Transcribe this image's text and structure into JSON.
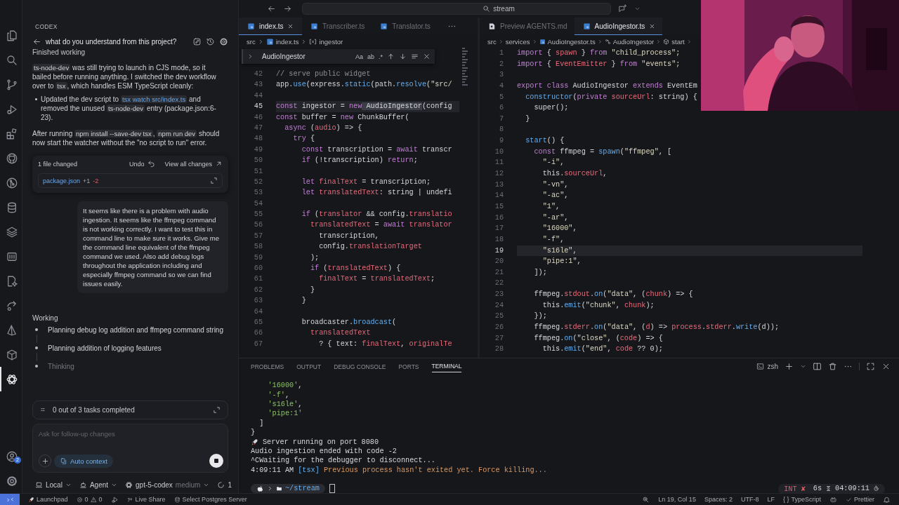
{
  "titlebar": {
    "search": "stream"
  },
  "activity_bar": {
    "items": [
      {
        "selected": false
      },
      {
        "selected": false
      },
      {
        "selected": false
      },
      {
        "selected": false
      },
      {
        "selected": false
      },
      {
        "selected": false
      },
      {
        "selected": false
      },
      {
        "selected": false
      },
      {
        "selected": false
      },
      {
        "selected": false
      },
      {
        "selected": false
      },
      {
        "selected": false
      },
      {
        "selected": false
      },
      {
        "selected": false
      },
      {
        "selected": true
      }
    ],
    "account_badge": "2"
  },
  "codex": {
    "title": "CODEX",
    "thread_title": "what do you understand from this project?",
    "status": "Finished working",
    "blocks": [
      {
        "kind": "para",
        "segs": [
          {
            "text": "ts-node-dev",
            "kind": "code"
          },
          {
            "text": " was still trying to launch in CJS mode, so it bailed before running anything. I switched the dev workflow over to ",
            "kind": "plain"
          },
          {
            "text": "tsx",
            "kind": "code"
          },
          {
            "text": ", which handles ESM TypeScript cleanly:",
            "kind": "plain"
          }
        ]
      },
      {
        "kind": "bullet",
        "segs": [
          {
            "text": "Updated the dev script to ",
            "kind": "plain"
          },
          {
            "text": "tsx watch src/index.ts",
            "kind": "link"
          },
          {
            "text": " and removed the unused ",
            "kind": "plain"
          },
          {
            "text": "ts-node-dev",
            "kind": "code"
          },
          {
            "text": " entry (package.json:6-23).",
            "kind": "plain"
          }
        ]
      },
      {
        "kind": "para",
        "segs": [
          {
            "text": "After running ",
            "kind": "plain"
          },
          {
            "text": "npm install --save-dev tsx",
            "kind": "code"
          },
          {
            "text": ", ",
            "kind": "plain"
          },
          {
            "text": "npm run dev",
            "kind": "code"
          },
          {
            "text": " should now start the watcher without the \"no script to run\" error.",
            "kind": "plain"
          }
        ]
      }
    ],
    "changes": {
      "summary": "1 file changed",
      "undo": "Undo",
      "view_all": "View all changes",
      "file": "package.json",
      "added": "+1",
      "removed": "-2"
    },
    "user_message": "It seems like there is a problem with audio ingestion. It seems like the ffmpeg command is not working correctly. I want to test this in command line to make sure it works. Give me the command line equivalent of the ffmpeg command we used. Also add debug logs throughout the application including and especially ffmpeg command so we can find issues easily.",
    "working": {
      "title": "Working",
      "steps": [
        {
          "text": "Planning debug log addition and ffmpeg command string",
          "current": false
        },
        {
          "text": "Planning addition of logging features",
          "current": false
        },
        {
          "text": "Thinking",
          "current": true
        }
      ]
    },
    "tasks": "0 out of 3 tasks completed",
    "composer": {
      "placeholder": "Ask for follow-up changes",
      "context": "Auto context"
    },
    "footer": {
      "location": "Local",
      "mode": "Agent",
      "model": "gpt-5-codex",
      "effort": "medium",
      "usage": "1"
    }
  },
  "editors": [
    {
      "tabs": [
        {
          "label": "index.ts",
          "kind": "ts",
          "selected": true
        },
        {
          "label": "Transcriber.ts",
          "kind": "ts",
          "selected": false
        },
        {
          "label": "Translator.ts",
          "kind": "ts",
          "selected": false
        }
      ],
      "breadcrumbs": [
        {
          "label": "src",
          "kind": "folder"
        },
        {
          "label": "index.ts",
          "kind": "file"
        },
        {
          "label": "ingestor",
          "kind": "variable"
        }
      ],
      "find": {
        "query": "AudioIngestor",
        "options": [
          "Aa",
          "ab",
          ".*"
        ]
      },
      "lines": [
        {
          "n": "42",
          "current": false,
          "segs": [
            {
              "text": "// serve public widget",
              "kind": "c"
            }
          ]
        },
        {
          "n": "43",
          "current": false,
          "segs": [
            {
              "text": "app.",
              "kind": "p"
            },
            {
              "text": "use",
              "kind": "f"
            },
            {
              "text": "(express.",
              "kind": "p"
            },
            {
              "text": "static",
              "kind": "f"
            },
            {
              "text": "(path.",
              "kind": "p"
            },
            {
              "text": "resolve",
              "kind": "f"
            },
            {
              "text": "(\"src/",
              "kind": "s"
            }
          ]
        },
        {
          "n": "44",
          "current": false
        },
        {
          "n": "45",
          "current": true,
          "segs": [
            {
              "text": "const",
              "kind": "k"
            },
            {
              "text": " ingestor = ",
              "kind": "p"
            },
            {
              "text": "new",
              "kind": "k"
            },
            {
              "text": " AudioIngestor",
              "kind": "m"
            },
            {
              "text": "(config",
              "kind": "p"
            }
          ]
        },
        {
          "n": "46",
          "current": false,
          "segs": [
            {
              "text": "const",
              "kind": "k"
            },
            {
              "text": " buffer = ",
              "kind": "p"
            },
            {
              "text": "new",
              "kind": "k"
            },
            {
              "text": " ChunkBuffer(",
              "kind": "p"
            }
          ]
        },
        {
          "n": "47",
          "current": false,
          "segs": [
            {
              "text": "  async",
              "kind": "k"
            },
            {
              "text": " (",
              "kind": "p"
            },
            {
              "text": "audio",
              "kind": "v"
            },
            {
              "text": ") => {",
              "kind": "p"
            }
          ]
        },
        {
          "n": "48",
          "current": false,
          "segs": [
            {
              "text": "    try",
              "kind": "k"
            },
            {
              "text": " {",
              "kind": "p"
            }
          ]
        },
        {
          "n": "49",
          "current": false,
          "segs": [
            {
              "text": "      const",
              "kind": "k"
            },
            {
              "text": " transcription = ",
              "kind": "p"
            },
            {
              "text": "await",
              "kind": "k"
            },
            {
              "text": " transcr",
              "kind": "p"
            }
          ]
        },
        {
          "n": "50",
          "current": false,
          "segs": [
            {
              "text": "      if",
              "kind": "k"
            },
            {
              "text": " (!transcription) ",
              "kind": "p"
            },
            {
              "text": "return",
              "kind": "k"
            },
            {
              "text": ";",
              "kind": "p"
            }
          ]
        },
        {
          "n": "51",
          "current": false
        },
        {
          "n": "52",
          "current": false,
          "segs": [
            {
              "text": "      let",
              "kind": "k"
            },
            {
              "text": " finalText",
              "kind": "v"
            },
            {
              "text": " = transcription;",
              "kind": "p"
            }
          ]
        },
        {
          "n": "53",
          "current": false,
          "segs": [
            {
              "text": "      let",
              "kind": "k"
            },
            {
              "text": " translatedText",
              "kind": "v"
            },
            {
              "text": ": string | undefi",
              "kind": "p"
            }
          ]
        },
        {
          "n": "54",
          "current": false
        },
        {
          "n": "55",
          "current": false,
          "segs": [
            {
              "text": "      if",
              "kind": "k"
            },
            {
              "text": " (",
              "kind": "p"
            },
            {
              "text": "translator",
              "kind": "v"
            },
            {
              "text": " && config.",
              "kind": "p"
            },
            {
              "text": "translatio",
              "kind": "v"
            }
          ]
        },
        {
          "n": "56",
          "current": false,
          "segs": [
            {
              "text": "        translatedText",
              "kind": "v"
            },
            {
              "text": " = ",
              "kind": "p"
            },
            {
              "text": "await",
              "kind": "k"
            },
            {
              "text": " translator",
              "kind": "v"
            }
          ]
        },
        {
          "n": "57",
          "current": false,
          "segs": [
            {
              "text": "          transcription,",
              "kind": "p"
            }
          ]
        },
        {
          "n": "58",
          "current": false,
          "segs": [
            {
              "text": "          config.",
              "kind": "p"
            },
            {
              "text": "translationTarget",
              "kind": "v"
            }
          ]
        },
        {
          "n": "59",
          "current": false,
          "segs": [
            {
              "text": "        );",
              "kind": "p"
            }
          ]
        },
        {
          "n": "60",
          "current": false,
          "segs": [
            {
              "text": "        if",
              "kind": "k"
            },
            {
              "text": " (",
              "kind": "p"
            },
            {
              "text": "translatedText",
              "kind": "v"
            },
            {
              "text": ") {",
              "kind": "p"
            }
          ]
        },
        {
          "n": "61",
          "current": false,
          "segs": [
            {
              "text": "          finalText",
              "kind": "v"
            },
            {
              "text": " = ",
              "kind": "p"
            },
            {
              "text": "translatedText",
              "kind": "v"
            },
            {
              "text": ";",
              "kind": "p"
            }
          ]
        },
        {
          "n": "62",
          "current": false,
          "segs": [
            {
              "text": "        }",
              "kind": "p"
            }
          ]
        },
        {
          "n": "63",
          "current": false,
          "segs": [
            {
              "text": "      }",
              "kind": "p"
            }
          ]
        },
        {
          "n": "64",
          "current": false
        },
        {
          "n": "65",
          "current": false,
          "segs": [
            {
              "text": "      broadcaster.",
              "kind": "p"
            },
            {
              "text": "broadcast",
              "kind": "f"
            },
            {
              "text": "(",
              "kind": "p"
            }
          ]
        },
        {
          "n": "66",
          "current": false,
          "segs": [
            {
              "text": "        translatedText",
              "kind": "v"
            }
          ]
        },
        {
          "n": "67",
          "current": false,
          "segs": [
            {
              "text": "          ? { text: ",
              "kind": "p"
            },
            {
              "text": "finalText",
              "kind": "v"
            },
            {
              "text": ", ",
              "kind": "p"
            },
            {
              "text": "originalTe",
              "kind": "v"
            }
          ]
        }
      ]
    },
    {
      "tabs": [
        {
          "label": "Preview AGENTS.md",
          "kind": "preview",
          "selected": false
        },
        {
          "label": "AudioIngestor.ts",
          "kind": "ts",
          "selected": true
        }
      ],
      "breadcrumbs": [
        {
          "label": "src",
          "kind": "folder"
        },
        {
          "label": "services",
          "kind": "folder"
        },
        {
          "label": "AudioIngestor.ts",
          "kind": "file"
        },
        {
          "label": "AudioIngestor",
          "kind": "class"
        },
        {
          "label": "start",
          "kind": "method"
        }
      ],
      "breadcrumb_more": true,
      "lines": [
        {
          "n": "1",
          "current": false,
          "segs": [
            {
              "text": "import",
              "kind": "k"
            },
            {
              "text": " { ",
              "kind": "p"
            },
            {
              "text": "spawn",
              "kind": "v"
            },
            {
              "text": " } ",
              "kind": "p"
            },
            {
              "text": "from",
              "kind": "k"
            },
            {
              "text": " \"child_process\";",
              "kind": "s"
            }
          ]
        },
        {
          "n": "2",
          "current": false,
          "segs": [
            {
              "text": "import",
              "kind": "k"
            },
            {
              "text": " { ",
              "kind": "p"
            },
            {
              "text": "EventEmitter",
              "kind": "v"
            },
            {
              "text": " } ",
              "kind": "p"
            },
            {
              "text": "from",
              "kind": "k"
            },
            {
              "text": " \"events\";",
              "kind": "s"
            }
          ]
        },
        {
          "n": "3",
          "current": false
        },
        {
          "n": "4",
          "current": false,
          "segs": [
            {
              "text": "export class",
              "kind": "k"
            },
            {
              "text": " AudioIngestor ",
              "kind": "p"
            },
            {
              "text": "extends",
              "kind": "k"
            },
            {
              "text": " EventEm",
              "kind": "p"
            }
          ]
        },
        {
          "n": "5",
          "current": false,
          "segs": [
            {
              "text": "  constructor",
              "kind": "f"
            },
            {
              "text": "(",
              "kind": "p"
            },
            {
              "text": "private",
              "kind": "k"
            },
            {
              "text": " sourceUrl",
              "kind": "v"
            },
            {
              "text": ": string) {",
              "kind": "p"
            }
          ]
        },
        {
          "n": "6",
          "current": false,
          "segs": [
            {
              "text": "    super();",
              "kind": "p"
            }
          ]
        },
        {
          "n": "7",
          "current": false,
          "segs": [
            {
              "text": "  }",
              "kind": "p"
            }
          ]
        },
        {
          "n": "8",
          "current": false
        },
        {
          "n": "9",
          "current": false,
          "segs": [
            {
              "text": "  start",
              "kind": "f"
            },
            {
              "text": "() {",
              "kind": "p"
            }
          ]
        },
        {
          "n": "10",
          "current": false,
          "segs": [
            {
              "text": "    const",
              "kind": "k"
            },
            {
              "text": " ffmpeg = ",
              "kind": "p"
            },
            {
              "text": "spawn",
              "kind": "f"
            },
            {
              "text": "(",
              "kind": "p"
            },
            {
              "text": "\"ffmpeg\"",
              "kind": "s"
            },
            {
              "text": ", [",
              "kind": "p"
            }
          ]
        },
        {
          "n": "11",
          "current": false,
          "segs": [
            {
              "text": "      \"-i\"",
              "kind": "s"
            },
            {
              "text": ",",
              "kind": "p"
            }
          ]
        },
        {
          "n": "12",
          "current": false,
          "segs": [
            {
              "text": "      this.",
              "kind": "p"
            },
            {
              "text": "sourceUrl",
              "kind": "v"
            },
            {
              "text": ",",
              "kind": "p"
            }
          ]
        },
        {
          "n": "13",
          "current": false,
          "segs": [
            {
              "text": "      \"-vn\"",
              "kind": "s"
            },
            {
              "text": ",",
              "kind": "p"
            }
          ]
        },
        {
          "n": "14",
          "current": false,
          "segs": [
            {
              "text": "      \"-ac\"",
              "kind": "s"
            },
            {
              "text": ",",
              "kind": "p"
            }
          ]
        },
        {
          "n": "15",
          "current": false,
          "segs": [
            {
              "text": "      \"1\"",
              "kind": "s"
            },
            {
              "text": ",",
              "kind": "p"
            }
          ]
        },
        {
          "n": "16",
          "current": false,
          "segs": [
            {
              "text": "      \"-ar\"",
              "kind": "s"
            },
            {
              "text": ",",
              "kind": "p"
            }
          ]
        },
        {
          "n": "17",
          "current": false,
          "segs": [
            {
              "text": "      \"16000\"",
              "kind": "s"
            },
            {
              "text": ",",
              "kind": "p"
            }
          ]
        },
        {
          "n": "18",
          "current": false,
          "segs": [
            {
              "text": "      \"-f\"",
              "kind": "s"
            },
            {
              "text": ",",
              "kind": "p"
            }
          ]
        },
        {
          "n": "19",
          "current": true,
          "segs": [
            {
              "text": "      \"s16le\"",
              "kind": "s"
            },
            {
              "text": ",",
              "kind": "p"
            }
          ]
        },
        {
          "n": "20",
          "current": false,
          "segs": [
            {
              "text": "      \"pipe:1\"",
              "kind": "s"
            },
            {
              "text": ",",
              "kind": "p"
            }
          ]
        },
        {
          "n": "21",
          "current": false,
          "segs": [
            {
              "text": "    ]);",
              "kind": "p"
            }
          ]
        },
        {
          "n": "22",
          "current": false
        },
        {
          "n": "23",
          "current": false,
          "segs": [
            {
              "text": "    ffmpeg.",
              "kind": "p"
            },
            {
              "text": "stdout",
              "kind": "v"
            },
            {
              "text": ".",
              "kind": "p"
            },
            {
              "text": "on",
              "kind": "f"
            },
            {
              "text": "(",
              "kind": "p"
            },
            {
              "text": "\"data\"",
              "kind": "s"
            },
            {
              "text": ", (",
              "kind": "p"
            },
            {
              "text": "chunk",
              "kind": "v"
            },
            {
              "text": ") => {",
              "kind": "p"
            }
          ]
        },
        {
          "n": "24",
          "current": false,
          "segs": [
            {
              "text": "      this.",
              "kind": "p"
            },
            {
              "text": "emit",
              "kind": "f"
            },
            {
              "text": "(",
              "kind": "p"
            },
            {
              "text": "\"chunk\"",
              "kind": "s"
            },
            {
              "text": ", ",
              "kind": "p"
            },
            {
              "text": "chunk",
              "kind": "v"
            },
            {
              "text": ");",
              "kind": "p"
            }
          ]
        },
        {
          "n": "25",
          "current": false,
          "segs": [
            {
              "text": "    });",
              "kind": "p"
            }
          ]
        },
        {
          "n": "26",
          "current": false,
          "segs": [
            {
              "text": "    ffmpeg.",
              "kind": "p"
            },
            {
              "text": "stderr",
              "kind": "v"
            },
            {
              "text": ".",
              "kind": "p"
            },
            {
              "text": "on",
              "kind": "f"
            },
            {
              "text": "(",
              "kind": "p"
            },
            {
              "text": "\"data\"",
              "kind": "s"
            },
            {
              "text": ", (",
              "kind": "p"
            },
            {
              "text": "d",
              "kind": "v"
            },
            {
              "text": ") => ",
              "kind": "p"
            },
            {
              "text": "process",
              "kind": "v"
            },
            {
              "text": ".",
              "kind": "p"
            },
            {
              "text": "stderr",
              "kind": "v"
            },
            {
              "text": ".",
              "kind": "p"
            },
            {
              "text": "write",
              "kind": "f"
            },
            {
              "text": "(d));",
              "kind": "p"
            }
          ]
        },
        {
          "n": "27",
          "current": false,
          "segs": [
            {
              "text": "    ffmpeg.",
              "kind": "p"
            },
            {
              "text": "on",
              "kind": "f"
            },
            {
              "text": "(",
              "kind": "p"
            },
            {
              "text": "\"close\"",
              "kind": "s"
            },
            {
              "text": ", (",
              "kind": "p"
            },
            {
              "text": "code",
              "kind": "v"
            },
            {
              "text": ") => {",
              "kind": "p"
            }
          ]
        },
        {
          "n": "28",
          "current": false,
          "segs": [
            {
              "text": "      this.",
              "kind": "p"
            },
            {
              "text": "emit",
              "kind": "f"
            },
            {
              "text": "(",
              "kind": "p"
            },
            {
              "text": "\"end\"",
              "kind": "s"
            },
            {
              "text": ", ",
              "kind": "p"
            },
            {
              "text": "code",
              "kind": "v"
            },
            {
              "text": " ?? 0);",
              "kind": "p"
            }
          ]
        }
      ]
    }
  ],
  "panel": {
    "tabs": [
      {
        "label": "PROBLEMS",
        "selected": false
      },
      {
        "label": "OUTPUT",
        "selected": false
      },
      {
        "label": "DEBUG CONSOLE",
        "selected": false
      },
      {
        "label": "PORTS",
        "selected": false
      },
      {
        "label": "TERMINAL",
        "selected": true
      }
    ],
    "shell": "zsh",
    "lines": [
      {
        "kind": "out",
        "segs": [
          {
            "text": "    '16000'",
            "kind": "g"
          },
          {
            "text": ",",
            "kind": "p"
          }
        ]
      },
      {
        "kind": "out",
        "segs": [
          {
            "text": "    '-f'",
            "kind": "g"
          },
          {
            "text": ",",
            "kind": "p"
          }
        ]
      },
      {
        "kind": "out",
        "segs": [
          {
            "text": "    's16le'",
            "kind": "g"
          },
          {
            "text": ",",
            "kind": "p"
          }
        ]
      },
      {
        "kind": "out",
        "segs": [
          {
            "text": "    'pipe:1'",
            "kind": "g"
          }
        ]
      },
      {
        "kind": "out",
        "segs": [
          {
            "text": "  ]",
            "kind": "p"
          }
        ]
      },
      {
        "kind": "out",
        "segs": [
          {
            "text": "}",
            "kind": "p"
          }
        ]
      },
      {
        "kind": "event",
        "segs": [
          {
            "text": "Server running on port 8080",
            "kind": "p"
          }
        ]
      },
      {
        "kind": "out",
        "segs": [
          {
            "text": "Audio ingestion ended with code -2",
            "kind": "p"
          }
        ]
      },
      {
        "kind": "out",
        "segs": [
          {
            "text": "^CWaiting for the debugger to disconnect...",
            "kind": "p"
          }
        ]
      },
      {
        "kind": "out",
        "segs": [
          {
            "text": "4:09:11 AM ",
            "kind": "p"
          },
          {
            "text": "[tsx]",
            "kind": "b"
          },
          {
            "text": " Previous process hasn't exited yet. Force killing...",
            "kind": "o"
          }
        ]
      }
    ],
    "prompt": {
      "path": "~/stream",
      "status": "INT ✘",
      "duration": "6s",
      "time": "04:09:11"
    }
  },
  "status_bar": {
    "left": [
      {
        "kind": "remote"
      },
      {
        "kind": "launchpad",
        "label": "Launchpad"
      },
      {
        "kind": "problems",
        "errors": "0",
        "warnings": "0"
      },
      {
        "kind": "debug"
      },
      {
        "kind": "liveshare",
        "label": "Live Share"
      },
      {
        "kind": "postgres",
        "label": "Select Postgres Server"
      }
    ],
    "right": [
      {
        "kind": "zoom"
      },
      {
        "kind": "text",
        "label": "Ln 19, Col 15"
      },
      {
        "kind": "text",
        "label": "Spaces: 2"
      },
      {
        "kind": "text",
        "label": "UTF-8"
      },
      {
        "kind": "text",
        "label": "LF"
      },
      {
        "kind": "language",
        "glyph": "{ }",
        "label": "TypeScript"
      },
      {
        "kind": "copilot"
      },
      {
        "kind": "prettier",
        "label": "Prettier"
      },
      {
        "kind": "bell"
      }
    ]
  }
}
